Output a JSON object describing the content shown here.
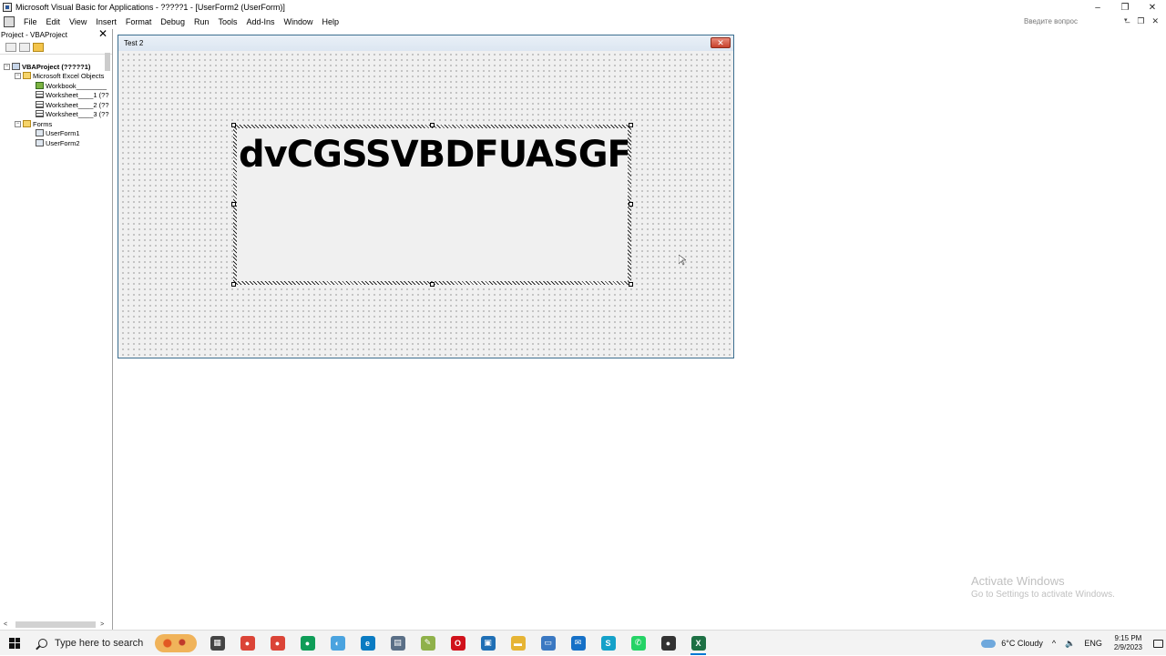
{
  "window": {
    "title": "Microsoft Visual Basic for Applications - ?????1 - [UserForm2 (UserForm)]",
    "minimize": "–",
    "restore": "❐",
    "close": "✕"
  },
  "menu": {
    "items": [
      "File",
      "Edit",
      "View",
      "Insert",
      "Format",
      "Debug",
      "Run",
      "Tools",
      "Add-Ins",
      "Window",
      "Help"
    ],
    "ask_placeholder": "Введите вопрос",
    "ask_arrow": "▾",
    "mdi_minimize": "–",
    "mdi_restore": "❐",
    "mdi_close": "✕"
  },
  "project_explorer": {
    "title": "Project - VBAProject",
    "close": "✕",
    "tree": [
      {
        "label": "VBAProject (?????1)",
        "toggle": "−"
      },
      {
        "label": "Microsoft Excel Objects",
        "toggle": "−"
      },
      {
        "label": "Workbook________"
      },
      {
        "label": "Worksheet____1 (??"
      },
      {
        "label": "Worksheet____2 (??"
      },
      {
        "label": "Worksheet____3 (??"
      },
      {
        "label": "Forms",
        "toggle": "−"
      },
      {
        "label": "UserForm1"
      },
      {
        "label": "UserForm2"
      }
    ],
    "scroll_left": "<",
    "scroll_right": ">"
  },
  "userform": {
    "caption": "Test 2",
    "close": "✕",
    "label_text": "dvCGSSVBDFUASGF"
  },
  "watermark": {
    "line1": "Activate Windows",
    "line2": "Go to Settings to activate Windows."
  },
  "taskbar": {
    "search_placeholder": "Type here to search",
    "apps": [
      {
        "icon": "task-view-icon",
        "color": "#444444",
        "glyph": "▦"
      },
      {
        "icon": "chrome-icon",
        "color": "#db4437",
        "glyph": "●"
      },
      {
        "icon": "chrome-icon",
        "color": "#db4437",
        "glyph": "●"
      },
      {
        "icon": "chrome-icon",
        "color": "#0f9d58",
        "glyph": "●"
      },
      {
        "icon": "browser-icon",
        "color": "#4aa3df",
        "glyph": "◐"
      },
      {
        "icon": "edge-icon",
        "color": "#0a7bc2",
        "glyph": "e"
      },
      {
        "icon": "calculator-icon",
        "color": "#5a6f86",
        "glyph": "▤"
      },
      {
        "icon": "pen-icon",
        "color": "#8fb14a",
        "glyph": "✎"
      },
      {
        "icon": "opera-icon",
        "color": "#d0111b",
        "glyph": "O"
      },
      {
        "icon": "store-icon",
        "color": "#1f6fb5",
        "glyph": "▣"
      },
      {
        "icon": "folder-icon",
        "color": "#e6b434",
        "glyph": "▬"
      },
      {
        "icon": "network-icon",
        "color": "#3a78c2",
        "glyph": "▭"
      },
      {
        "icon": "mail-icon",
        "color": "#1570c7",
        "glyph": "✉"
      },
      {
        "icon": "app-icon",
        "color": "#14a1c9",
        "glyph": "S"
      },
      {
        "icon": "whatsapp-icon",
        "color": "#25d366",
        "glyph": "✆"
      },
      {
        "icon": "record-icon",
        "color": "#333333",
        "glyph": "●"
      },
      {
        "icon": "excel-icon",
        "color": "#1d7044",
        "glyph": "X"
      }
    ],
    "weather": "6°C  Cloudy",
    "tray_chevron": "^",
    "volume": "🔈",
    "language": "ENG",
    "time": "9:15 PM",
    "date": "2/9/2023"
  }
}
